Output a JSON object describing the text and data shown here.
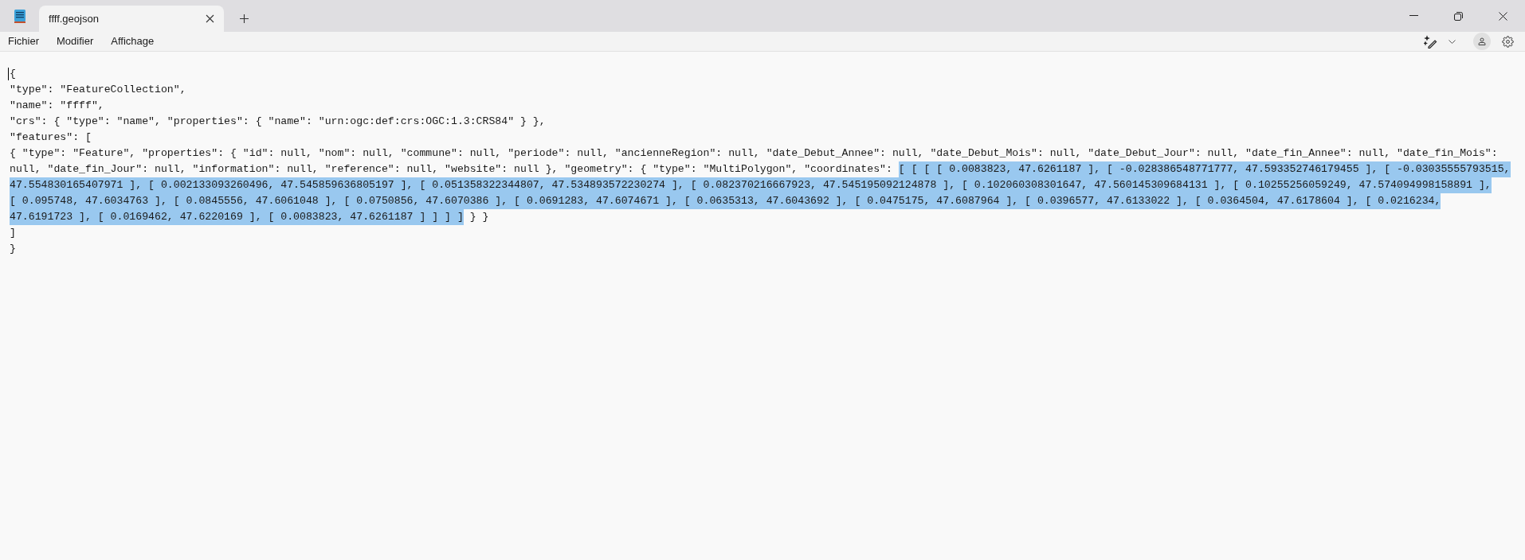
{
  "tab": {
    "title": "ffff.geojson",
    "selected": true
  },
  "menu": [
    "Fichier",
    "Modifier",
    "Affichage"
  ],
  "editor": {
    "lines": [
      {
        "segments": [
          {
            "text": "{",
            "selected": false
          }
        ]
      },
      {
        "segments": [
          {
            "text": "\"type\": \"FeatureCollection\",",
            "selected": false
          }
        ]
      },
      {
        "segments": [
          {
            "text": "\"name\": \"ffff\",",
            "selected": false
          }
        ]
      },
      {
        "segments": [
          {
            "text": "\"crs\": { \"type\": \"name\", \"properties\": { \"name\": \"urn:ogc:def:crs:OGC:1.3:CRS84\" } },",
            "selected": false
          }
        ]
      },
      {
        "segments": [
          {
            "text": "\"features\": [",
            "selected": false
          }
        ]
      },
      {
        "segments": [
          {
            "text": "{ \"type\": \"Feature\", \"properties\": { \"id\": null, \"nom\": null, \"commune\": null, \"periode\": null, \"ancienneRegion\": null, \"date_Debut_Annee\": null, \"date_Debut_Mois\": null, \"date_Debut_Jour\": null, \"date_fin_Annee\": null, \"date_fin_Mois\":",
            "selected": false
          }
        ]
      },
      {
        "segments": [
          {
            "text": "null, \"date_fin_Jour\": null, \"information\": null, \"reference\": null, \"website\": null }, \"geometry\": { \"type\": \"MultiPolygon\", \"coordinates\": ",
            "selected": false
          },
          {
            "text": "[ [ [ [ 0.0083823, 47.6261187 ], [ -0.028386548771777, 47.593352746179455 ], [ -0.03035555793515,",
            "selected": true
          }
        ]
      },
      {
        "segments": [
          {
            "text": "47.554830165407971 ], [ 0.002133093260496, 47.545859636805197 ], [ 0.051358322344807, 47.534893572230274 ], [ 0.082370216667923, 47.545195092124878 ], [ 0.102060308301647, 47.560145309684131 ], [ 0.10255256059249, 47.574094998158891 ],",
            "selected": true
          }
        ]
      },
      {
        "segments": [
          {
            "text": "[ 0.095748, 47.6034763 ], [ 0.0845556, 47.6061048 ], [ 0.0750856, 47.6070386 ], [ 0.0691283, 47.6074671 ], [ 0.0635313, 47.6043692 ], [ 0.0475175, 47.6087964 ], [ 0.0396577, 47.6133022 ], [ 0.0364504, 47.6178604 ], [ 0.0216234,",
            "selected": true
          }
        ]
      },
      {
        "segments": [
          {
            "text": "47.6191723 ], [ 0.0169462, 47.6220169 ], [ 0.0083823, 47.6261187 ] ] ] ]",
            "selected": true
          },
          {
            "text": " } }",
            "selected": false
          }
        ]
      },
      {
        "segments": [
          {
            "text": "]",
            "selected": false
          }
        ]
      },
      {
        "segments": [
          {
            "text": "}",
            "selected": false
          }
        ]
      }
    ]
  }
}
